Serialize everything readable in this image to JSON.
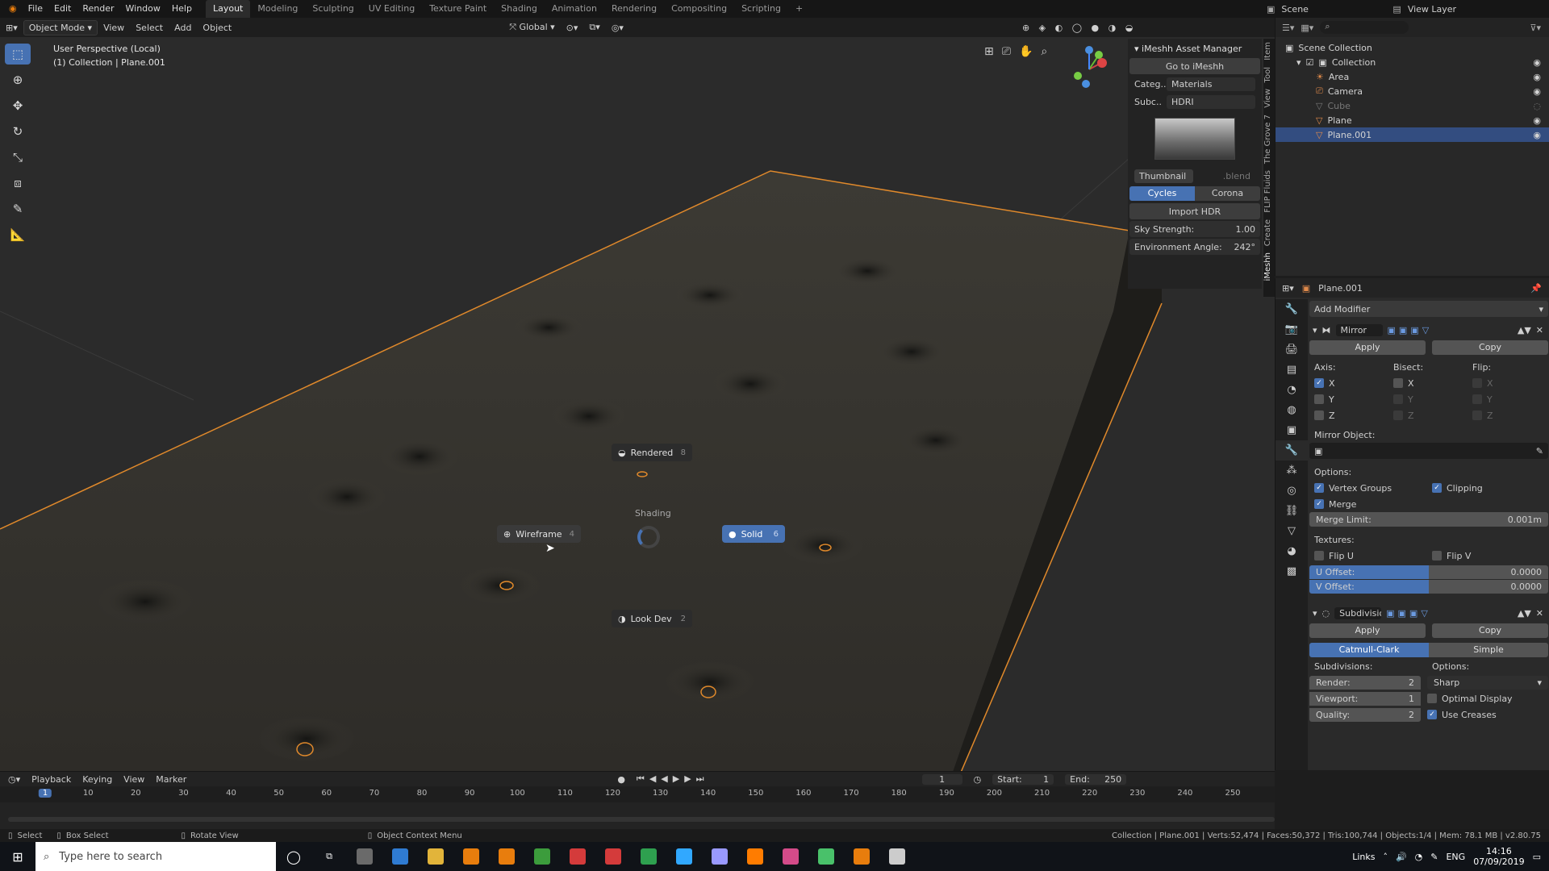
{
  "menu": [
    "File",
    "Edit",
    "Render",
    "Window",
    "Help"
  ],
  "workspaces": {
    "items": [
      "Layout",
      "Modeling",
      "Sculpting",
      "UV Editing",
      "Texture Paint",
      "Shading",
      "Animation",
      "Rendering",
      "Compositing",
      "Scripting"
    ],
    "active": "Layout"
  },
  "scene": {
    "scene_name": "Scene",
    "view_layer": "View Layer"
  },
  "header": {
    "mode": "Object Mode",
    "view": "View",
    "select": "Select",
    "add": "Add",
    "object": "Object",
    "orientation": "Global"
  },
  "viewport": {
    "perspective": "User Perspective (Local)",
    "collection_line": "(1) Collection | Plane.001"
  },
  "pie_menu": {
    "title": "Shading",
    "rendered": {
      "label": "Rendered",
      "key": "8"
    },
    "wireframe": {
      "label": "Wireframe",
      "key": "4"
    },
    "solid": {
      "label": "Solid",
      "key": "6"
    },
    "lookdev": {
      "label": "Look Dev",
      "key": "2"
    }
  },
  "imeshh": {
    "title": "iMeshh Asset Manager",
    "go_button": "Go to iMeshh",
    "category_label": "Categ..",
    "category_value": "Materials",
    "subcat_label": "Subc..",
    "subcat_value": "HDRI",
    "thumbnail_tab": "Thumbnail",
    "blend_tab": ".blend",
    "engine_cycles": "Cycles",
    "engine_corona": "Corona",
    "import_button": "Import HDR",
    "sky_label": "Sky Strength:",
    "sky_value": "1.00",
    "env_label": "Environment Angle:",
    "env_value": "242°"
  },
  "vertical_tabs": [
    "Item",
    "Tool",
    "View",
    "The Grove 7",
    "FLIP Fluids",
    "Create",
    "iMeshh"
  ],
  "outliner": {
    "root": "Scene Collection",
    "collection": "Collection",
    "items": [
      "Area",
      "Camera",
      "Cube",
      "Plane",
      "Plane.001"
    ],
    "selected": "Plane.001"
  },
  "properties": {
    "object_name": "Plane.001",
    "add_modifier": "Add Modifier",
    "mirror": {
      "name": "Mirror",
      "apply": "Apply",
      "copy": "Copy",
      "axis_label": "Axis:",
      "bisect_label": "Bisect:",
      "flip_label": "Flip:",
      "axes": [
        "X",
        "Y",
        "Z"
      ],
      "mirror_object_label": "Mirror Object:",
      "options_label": "Options:",
      "vertex_groups": "Vertex Groups",
      "clipping": "Clipping",
      "merge": "Merge",
      "merge_limit_label": "Merge Limit:",
      "merge_limit_value": "0.001m",
      "textures_label": "Textures:",
      "flip_u": "Flip U",
      "flip_v": "Flip V",
      "u_offset_label": "U Offset:",
      "u_offset_value": "0.0000",
      "v_offset_label": "V Offset:",
      "v_offset_value": "0.0000"
    },
    "subdivision": {
      "name": "Subdivision",
      "apply": "Apply",
      "copy": "Copy",
      "catmull": "Catmull-Clark",
      "simple": "Simple",
      "subdivisions_label": "Subdivisions:",
      "options_label": "Options:",
      "render_label": "Render:",
      "render_value": "2",
      "viewport_label": "Viewport:",
      "viewport_value": "1",
      "quality_label": "Quality:",
      "quality_value": "2",
      "uv_smooth": "Sharp",
      "optimal_display": "Optimal Display",
      "use_creases": "Use Creases"
    }
  },
  "timeline": {
    "playback": "Playback",
    "keying": "Keying",
    "view": "View",
    "marker": "Marker",
    "current_frame": "1",
    "start_label": "Start:",
    "start": "1",
    "end_label": "End:",
    "end": "250",
    "ticks": [
      "1",
      "10",
      "20",
      "30",
      "40",
      "50",
      "60",
      "70",
      "80",
      "90",
      "100",
      "110",
      "120",
      "130",
      "140",
      "150",
      "160",
      "170",
      "180",
      "190",
      "200",
      "210",
      "220",
      "230",
      "240",
      "250"
    ]
  },
  "status": {
    "select": "Select",
    "box_select": "Box Select",
    "rotate_view": "Rotate View",
    "context_menu": "Object Context Menu",
    "stats": "Collection | Plane.001 | Verts:52,474 | Faces:50,372 | Tris:100,744 | Objects:1/4 | Mem: 78.1 MB | v2.80.75"
  },
  "taskbar": {
    "search_placeholder": "Type here to search",
    "links": "Links",
    "lang": "ENG",
    "time": "14:16",
    "date": "07/09/2019",
    "app_colors": [
      "#6a6a6a",
      "#2f7bd2",
      "#e2b43a",
      "#e87d0d",
      "#e87d0d",
      "#3c9c3c",
      "#d43b3b",
      "#d43b3b",
      "#2ea04f",
      "#31a8ff",
      "#9999ff",
      "#ff7c00",
      "#d44b89",
      "#49c16a",
      "#e87d0d",
      "#cccccc"
    ]
  }
}
